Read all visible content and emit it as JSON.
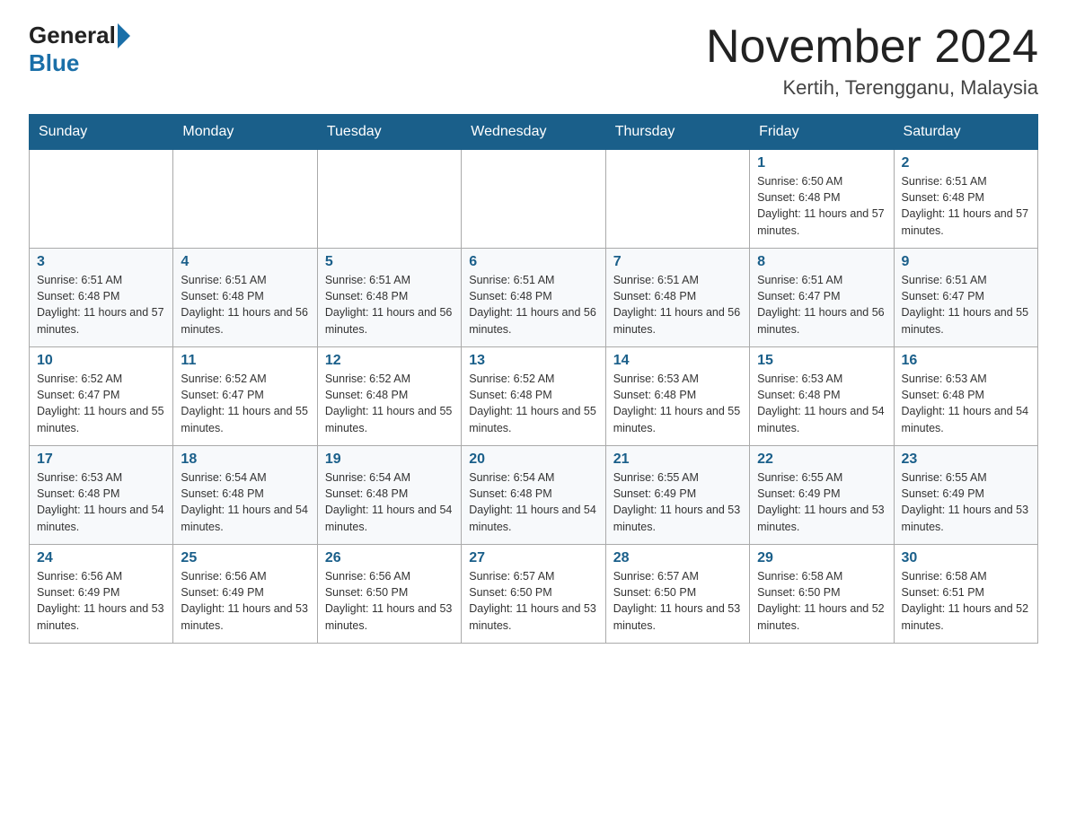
{
  "header": {
    "logo_general": "General",
    "logo_blue": "Blue",
    "month_title": "November 2024",
    "location": "Kertih, Terengganu, Malaysia"
  },
  "days_of_week": [
    "Sunday",
    "Monday",
    "Tuesday",
    "Wednesday",
    "Thursday",
    "Friday",
    "Saturday"
  ],
  "weeks": [
    [
      null,
      null,
      null,
      null,
      null,
      {
        "day": "1",
        "sunrise": "6:50 AM",
        "sunset": "6:48 PM",
        "daylight": "11 hours and 57 minutes."
      },
      {
        "day": "2",
        "sunrise": "6:51 AM",
        "sunset": "6:48 PM",
        "daylight": "11 hours and 57 minutes."
      }
    ],
    [
      {
        "day": "3",
        "sunrise": "6:51 AM",
        "sunset": "6:48 PM",
        "daylight": "11 hours and 57 minutes."
      },
      {
        "day": "4",
        "sunrise": "6:51 AM",
        "sunset": "6:48 PM",
        "daylight": "11 hours and 56 minutes."
      },
      {
        "day": "5",
        "sunrise": "6:51 AM",
        "sunset": "6:48 PM",
        "daylight": "11 hours and 56 minutes."
      },
      {
        "day": "6",
        "sunrise": "6:51 AM",
        "sunset": "6:48 PM",
        "daylight": "11 hours and 56 minutes."
      },
      {
        "day": "7",
        "sunrise": "6:51 AM",
        "sunset": "6:48 PM",
        "daylight": "11 hours and 56 minutes."
      },
      {
        "day": "8",
        "sunrise": "6:51 AM",
        "sunset": "6:47 PM",
        "daylight": "11 hours and 56 minutes."
      },
      {
        "day": "9",
        "sunrise": "6:51 AM",
        "sunset": "6:47 PM",
        "daylight": "11 hours and 55 minutes."
      }
    ],
    [
      {
        "day": "10",
        "sunrise": "6:52 AM",
        "sunset": "6:47 PM",
        "daylight": "11 hours and 55 minutes."
      },
      {
        "day": "11",
        "sunrise": "6:52 AM",
        "sunset": "6:47 PM",
        "daylight": "11 hours and 55 minutes."
      },
      {
        "day": "12",
        "sunrise": "6:52 AM",
        "sunset": "6:48 PM",
        "daylight": "11 hours and 55 minutes."
      },
      {
        "day": "13",
        "sunrise": "6:52 AM",
        "sunset": "6:48 PM",
        "daylight": "11 hours and 55 minutes."
      },
      {
        "day": "14",
        "sunrise": "6:53 AM",
        "sunset": "6:48 PM",
        "daylight": "11 hours and 55 minutes."
      },
      {
        "day": "15",
        "sunrise": "6:53 AM",
        "sunset": "6:48 PM",
        "daylight": "11 hours and 54 minutes."
      },
      {
        "day": "16",
        "sunrise": "6:53 AM",
        "sunset": "6:48 PM",
        "daylight": "11 hours and 54 minutes."
      }
    ],
    [
      {
        "day": "17",
        "sunrise": "6:53 AM",
        "sunset": "6:48 PM",
        "daylight": "11 hours and 54 minutes."
      },
      {
        "day": "18",
        "sunrise": "6:54 AM",
        "sunset": "6:48 PM",
        "daylight": "11 hours and 54 minutes."
      },
      {
        "day": "19",
        "sunrise": "6:54 AM",
        "sunset": "6:48 PM",
        "daylight": "11 hours and 54 minutes."
      },
      {
        "day": "20",
        "sunrise": "6:54 AM",
        "sunset": "6:48 PM",
        "daylight": "11 hours and 54 minutes."
      },
      {
        "day": "21",
        "sunrise": "6:55 AM",
        "sunset": "6:49 PM",
        "daylight": "11 hours and 53 minutes."
      },
      {
        "day": "22",
        "sunrise": "6:55 AM",
        "sunset": "6:49 PM",
        "daylight": "11 hours and 53 minutes."
      },
      {
        "day": "23",
        "sunrise": "6:55 AM",
        "sunset": "6:49 PM",
        "daylight": "11 hours and 53 minutes."
      }
    ],
    [
      {
        "day": "24",
        "sunrise": "6:56 AM",
        "sunset": "6:49 PM",
        "daylight": "11 hours and 53 minutes."
      },
      {
        "day": "25",
        "sunrise": "6:56 AM",
        "sunset": "6:49 PM",
        "daylight": "11 hours and 53 minutes."
      },
      {
        "day": "26",
        "sunrise": "6:56 AM",
        "sunset": "6:50 PM",
        "daylight": "11 hours and 53 minutes."
      },
      {
        "day": "27",
        "sunrise": "6:57 AM",
        "sunset": "6:50 PM",
        "daylight": "11 hours and 53 minutes."
      },
      {
        "day": "28",
        "sunrise": "6:57 AM",
        "sunset": "6:50 PM",
        "daylight": "11 hours and 53 minutes."
      },
      {
        "day": "29",
        "sunrise": "6:58 AM",
        "sunset": "6:50 PM",
        "daylight": "11 hours and 52 minutes."
      },
      {
        "day": "30",
        "sunrise": "6:58 AM",
        "sunset": "6:51 PM",
        "daylight": "11 hours and 52 minutes."
      }
    ]
  ]
}
